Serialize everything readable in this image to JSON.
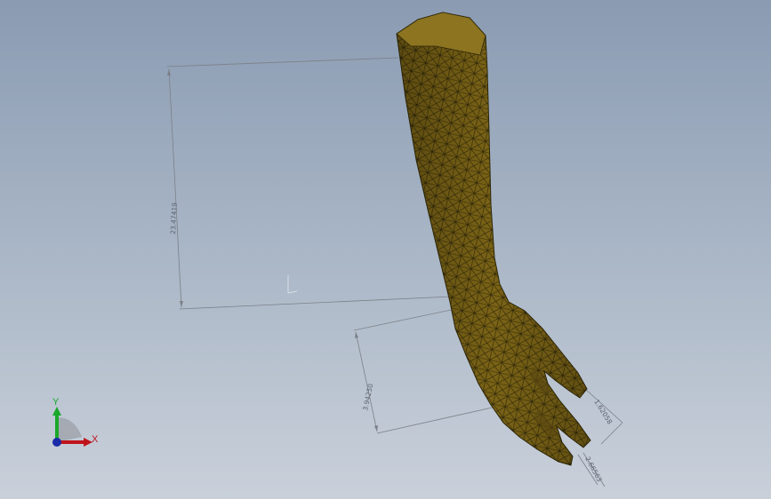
{
  "viewport": {
    "dimensions": [
      {
        "name": "forearm-length",
        "value": "23.47419"
      },
      {
        "name": "palm-length",
        "value": "3.94250"
      },
      {
        "name": "finger-width",
        "value": "1.62058"
      },
      {
        "name": "finger-offset",
        "value": "2.66563"
      }
    ],
    "triad": {
      "x_label": "X",
      "y_label": "Y"
    }
  },
  "colors": {
    "mesh_fill": "#7a6316",
    "mesh_line": "#2e2608",
    "dimension_line": "#7b8088",
    "axis_x": "#c0141c",
    "axis_y": "#1aa82a",
    "axis_z": "#1a2aa8"
  }
}
